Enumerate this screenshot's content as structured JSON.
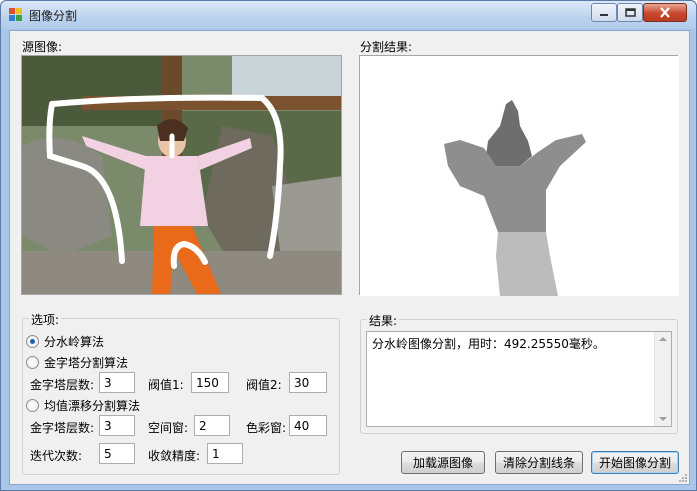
{
  "window": {
    "title": "图像分割"
  },
  "source": {
    "label": "源图像:"
  },
  "result_image": {
    "label": "分割结果:"
  },
  "options": {
    "group_title": "选项:",
    "watershed": {
      "label": "分水岭算法",
      "checked": true
    },
    "pyramid": {
      "label": "金字塔分割算法",
      "checked": false,
      "levels_label": "金字塔层数:",
      "levels_value": "3",
      "threshold1_label": "阀值1:",
      "threshold1_value": "150",
      "threshold2_label": "阀值2:",
      "threshold2_value": "30"
    },
    "meanshift": {
      "label": "均值漂移分割算法",
      "checked": false,
      "levels_label": "金字塔层数:",
      "levels_value": "3",
      "spatial_label": "空间窗:",
      "spatial_value": "2",
      "color_label": "色彩窗:",
      "color_value": "40",
      "iter_label": "迭代次数:",
      "iter_value": "5",
      "eps_label": "收敛精度:",
      "eps_value": "1"
    }
  },
  "results": {
    "group_title": "结果:",
    "text": "分水岭图像分割，用时：492.25550毫秒。"
  },
  "buttons": {
    "load": "加载源图像",
    "clear": "清除分割线条",
    "start": "开始图像分割"
  },
  "colors": {
    "accent": "#1f5fb3",
    "segment_dark": "#6e6e6e",
    "segment_mid": "#8e8e8e",
    "segment_light": "#bcbcbc"
  }
}
